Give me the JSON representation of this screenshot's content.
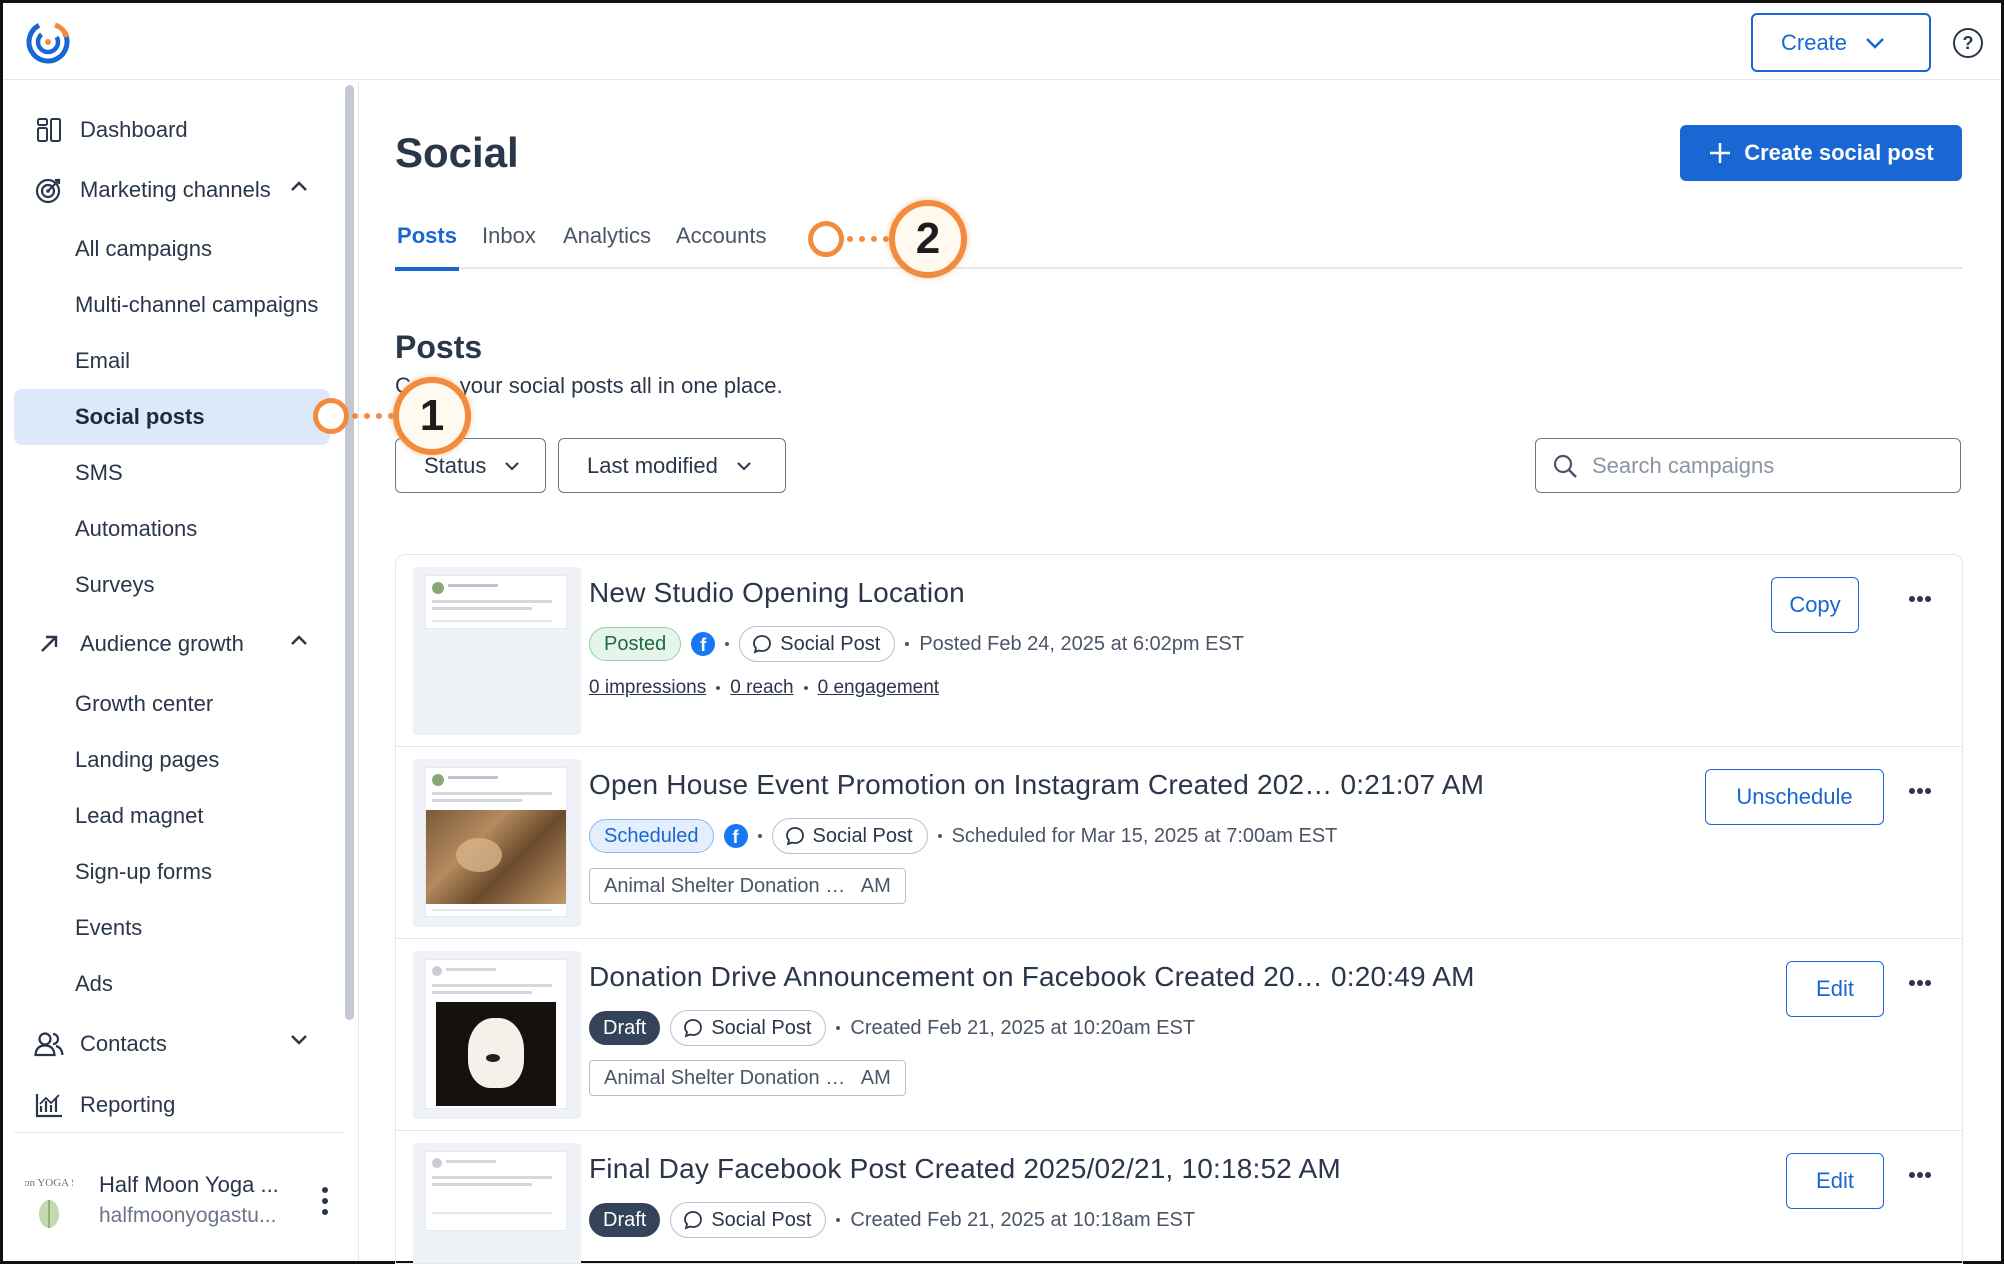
{
  "topbar": {
    "create_label": "Create",
    "help_glyph": "?"
  },
  "sidebar": {
    "dashboard": "Dashboard",
    "marketing_channels": "Marketing channels",
    "marketing_items": [
      "All campaigns",
      "Multi-channel campaigns",
      "Email",
      "Social posts",
      "SMS",
      "Automations",
      "Surveys"
    ],
    "audience_growth": "Audience growth",
    "audience_items": [
      "Growth center",
      "Landing pages",
      "Lead magnet",
      "Sign-up forms",
      "Events",
      "Ads"
    ],
    "contacts": "Contacts",
    "reporting": "Reporting",
    "account_name": "Half Moon Yoga ...",
    "account_email": "halfmoonyogastu...",
    "account_logo_text": "Half Moon YOGA STUDIO"
  },
  "page": {
    "title": "Social",
    "cta_label": "Create social post",
    "tabs": [
      "Posts",
      "Inbox",
      "Analytics",
      "Accounts"
    ],
    "section_title": "Posts",
    "section_sub": "C     e your social posts all in one place.",
    "filters": [
      "Status",
      "Last modified"
    ],
    "search_placeholder": "Search campaigns"
  },
  "posts": [
    {
      "title": "New Studio Opening Location",
      "status": "Posted",
      "type": "Social Post",
      "date": "Posted Feb 24, 2025 at 6:02pm EST",
      "stats": [
        "0 impressions",
        "0 reach",
        "0 engagement"
      ],
      "action": "Copy"
    },
    {
      "title": "Open House Event Promotion on Instagram Created 202… 0:21:07 AM",
      "status": "Scheduled",
      "type": "Social Post",
      "date": "Scheduled for Mar 15, 2025 at 7:00am EST",
      "tag": "Animal Shelter Donation …   AM",
      "action": "Unschedule"
    },
    {
      "title": "Donation Drive Announcement on Facebook Created 20… 0:20:49 AM",
      "status": "Draft",
      "type": "Social Post",
      "date": "Created Feb 21, 2025 at 10:20am EST",
      "tag": "Animal Shelter Donation …   AM",
      "action": "Edit"
    },
    {
      "title": "Final Day Facebook Post Created 2025/02/21, 10:18:52 AM",
      "status": "Draft",
      "type": "Social Post",
      "date": "Created Feb 21, 2025 at 10:18am EST",
      "action": "Edit"
    }
  ],
  "callouts": [
    "1",
    "2"
  ],
  "colors": {
    "accent": "#1967d2",
    "callout": "#f38b3f",
    "active_nav_bg": "#dde9fb",
    "draft_badge": "#35435a"
  }
}
